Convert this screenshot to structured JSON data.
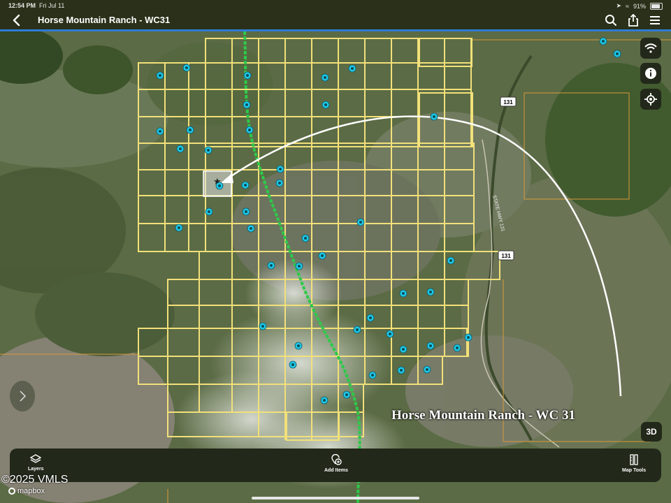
{
  "status_bar": {
    "time": "12:54 PM",
    "date": "Fri Jul 11",
    "battery": "91%"
  },
  "header": {
    "title": "Horse Mountain Ranch - WC31",
    "icons": [
      "back-icon",
      "search-icon",
      "share-icon",
      "menu-icon"
    ]
  },
  "map": {
    "label": "Horse Mountain Ranch - WC 31",
    "highways": [
      "131",
      "131"
    ],
    "road_name": "STATE HWY 131",
    "copyright": "©2025 VMLS",
    "attribution": "mapbox",
    "parcel_color": "#f2e07a",
    "marker_color": "#1fc8e6",
    "trail_color": "#2ec94a"
  },
  "side_buttons": {
    "wifi": "wifi-icon",
    "info": "info-icon",
    "locate": "locate-icon",
    "view_3d": "3D"
  },
  "toolbar": {
    "layers": "Layers",
    "add_items": "Add Items",
    "map_tools": "Map Tools"
  }
}
